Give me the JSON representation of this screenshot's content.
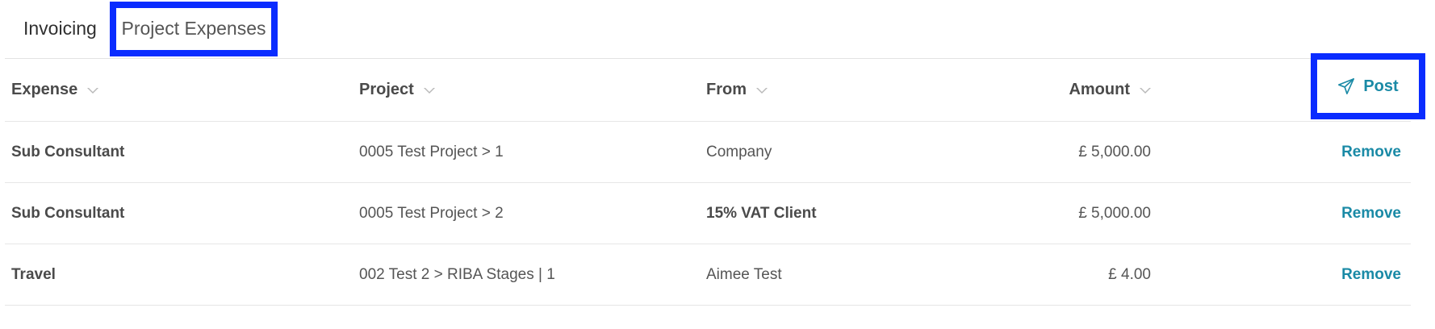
{
  "tabs": [
    {
      "label": "Invoicing",
      "active": false
    },
    {
      "label": "Project Expenses",
      "active": true
    }
  ],
  "table": {
    "columns": {
      "expense": "Expense",
      "project": "Project",
      "from": "From",
      "amount": "Amount"
    },
    "post_button": {
      "label": "Post",
      "icon": "paper-plane-icon"
    },
    "rows": [
      {
        "expense": "Sub Consultant",
        "project": "0005 Test Project > 1",
        "from": "Company",
        "from_bold": false,
        "amount": "£ 5,000.00",
        "action": "Remove"
      },
      {
        "expense": "Sub Consultant",
        "project": "0005 Test Project > 2",
        "from": "15% VAT Client",
        "from_bold": true,
        "amount": "£ 5,000.00",
        "action": "Remove"
      },
      {
        "expense": "Travel",
        "project": "002 Test 2 > RIBA Stages | 1",
        "from": "Aimee Test",
        "from_bold": false,
        "amount": "£ 4.00",
        "action": "Remove"
      }
    ]
  },
  "colors": {
    "highlight": "#0a2cff",
    "link": "#1a8aa6"
  }
}
